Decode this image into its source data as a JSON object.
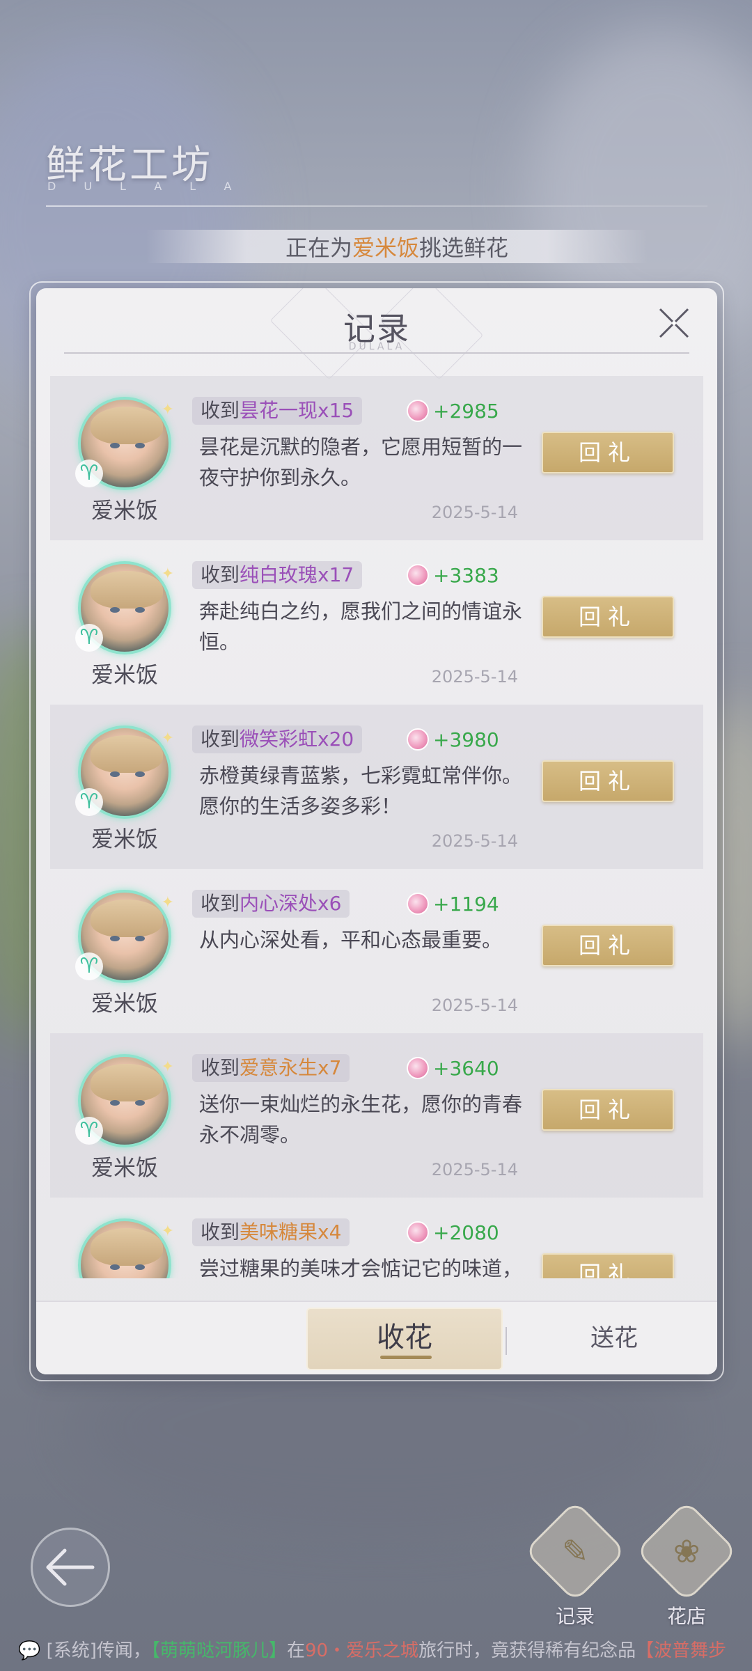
{
  "header": {
    "title": "鲜花工坊",
    "subtitle": "DULALA",
    "picking_prefix": "正在为",
    "picking_name": "爱米饭",
    "picking_suffix": "挑选鲜花"
  },
  "dialog": {
    "title": "记录",
    "title_sub": "DULALA",
    "close_icon": "close-icon"
  },
  "records": [
    {
      "sender": "爱米饭",
      "prefix": "收到",
      "gift": "昙花一现x15",
      "gift_color": "purple",
      "points": "+2985",
      "desc": "昙花是沉默的隐者，它愿用短暂的一夜守护你到永久。",
      "date": "2025-5-14",
      "button": "回礼"
    },
    {
      "sender": "爱米饭",
      "prefix": "收到",
      "gift": "纯白玫瑰x17",
      "gift_color": "purple",
      "points": "+3383",
      "desc": "奔赴纯白之约，愿我们之间的情谊永恒。",
      "date": "2025-5-14",
      "button": "回礼"
    },
    {
      "sender": "爱米饭",
      "prefix": "收到",
      "gift": "微笑彩虹x20",
      "gift_color": "purple",
      "points": "+3980",
      "desc": "赤橙黄绿青蓝紫，七彩霓虹常伴你。愿你的生活多姿多彩！",
      "date": "2025-5-14",
      "button": "回礼"
    },
    {
      "sender": "爱米饭",
      "prefix": "收到",
      "gift": "内心深处x6",
      "gift_color": "purple",
      "points": "+1194",
      "desc": "从内心深处看，平和心态最重要。",
      "date": "2025-5-14",
      "button": "回礼"
    },
    {
      "sender": "爱米饭",
      "prefix": "收到",
      "gift": "爱意永生x7",
      "gift_color": "orange",
      "points": "+3640",
      "desc": "送你一束灿烂的永生花，愿你的青春永不凋零。",
      "date": "2025-5-14",
      "button": "回礼"
    },
    {
      "sender": "",
      "prefix": "收到",
      "gift": "美味糖果x4",
      "gift_color": "orange",
      "points": "+2080",
      "desc": "尝过糖果的美味才会惦记它的味道，",
      "date": "",
      "button": "回礼"
    }
  ],
  "tabs": {
    "receive": "收花",
    "send": "送花"
  },
  "actions": {
    "records_label": "记录",
    "shop_label": "花店"
  },
  "ticker": {
    "p1": "[系统]传闻，",
    "p2": "【萌萌哒河豚儿】",
    "p3": "在",
    "p4": "90・爱乐之城",
    "p5": "旅行时，竟获得稀有纪念品",
    "p6": "【波普舞步"
  },
  "colors": {
    "gold_button": "#c9ab6f",
    "purple_gift": "#9a4fb8",
    "orange_gift": "#d6883c",
    "points_green": "#38a84b"
  }
}
